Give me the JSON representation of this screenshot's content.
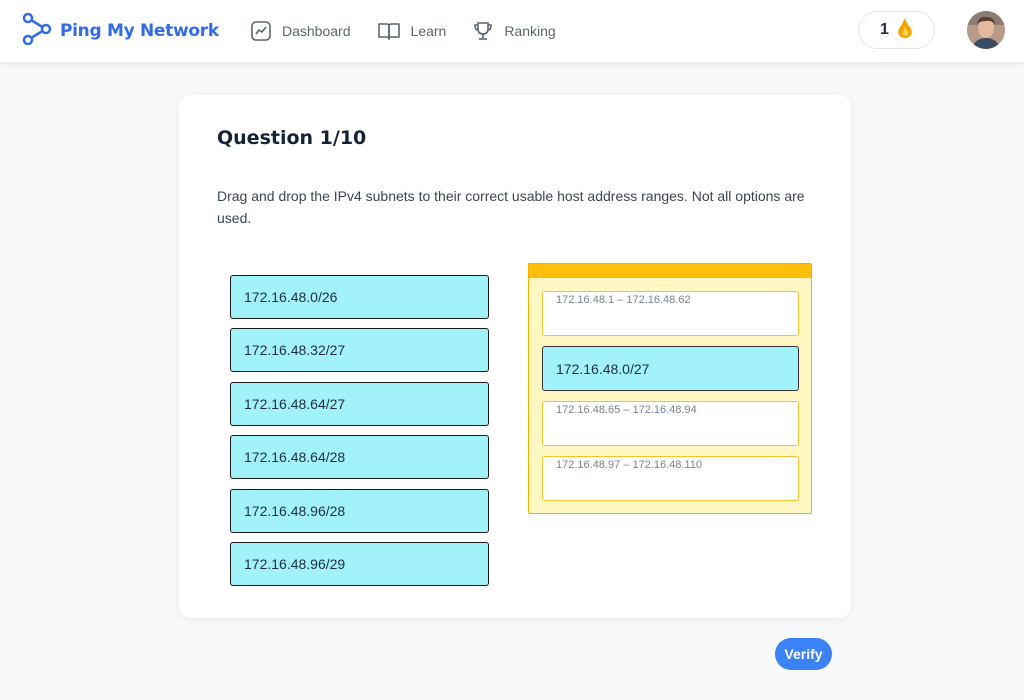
{
  "header": {
    "brand": "Ping My Network",
    "nav": [
      {
        "label": "Dashboard",
        "icon": "chart-line-icon"
      },
      {
        "label": "Learn",
        "icon": "book-icon"
      },
      {
        "label": "Ranking",
        "icon": "trophy-icon"
      }
    ],
    "streak_count": "1",
    "streak_icon": "flame-icon"
  },
  "question": {
    "title": "Question 1/10",
    "text": "Drag and drop the IPv4 subnets to their correct usable host address ranges. Not all options are used."
  },
  "options": [
    "172.16.48.0/26",
    "172.16.48.32/27",
    "172.16.48.64/27",
    "172.16.48.64/28",
    "172.16.48.96/28",
    "172.16.48.96/29"
  ],
  "targets": [
    {
      "range": "172.16.48.1 – 172.16.48.62",
      "answer": ""
    },
    {
      "range": "",
      "answer": "172.16.48.0/27"
    },
    {
      "range": "172.16.48.65 – 172.16.48.94",
      "answer": ""
    },
    {
      "range": "172.16.48.97 – 172.16.48.110",
      "answer": ""
    }
  ],
  "verify_label": "Verify",
  "colors": {
    "brand": "#2f6ce5",
    "option_bg": "#a2f2fb",
    "drop_panel_bg": "#fff7c2",
    "drop_panel_bar": "#ffbe0b",
    "verify_button": "#3b82f6"
  }
}
